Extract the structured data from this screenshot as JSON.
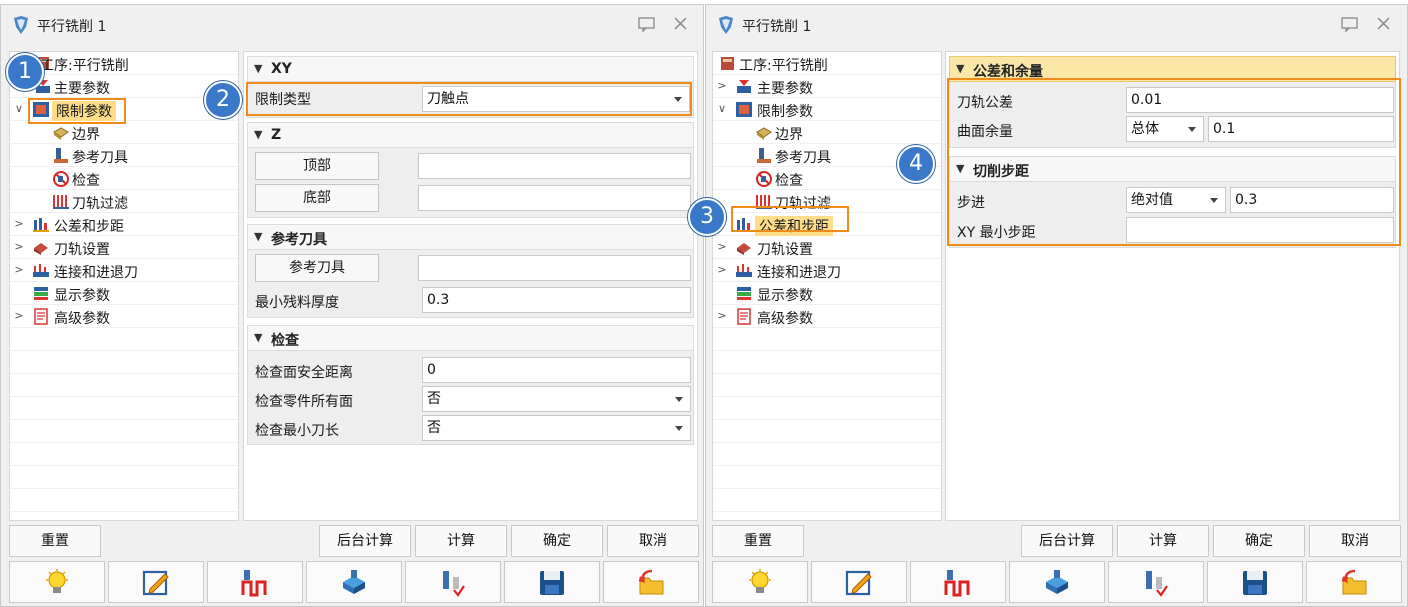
{
  "left_dialog": {
    "title": "平行铣削 1",
    "tree": {
      "items": [
        {
          "label": "工序:平行铣削"
        },
        {
          "label": "主要参数"
        },
        {
          "label": "限制参数"
        },
        {
          "label": "边界"
        },
        {
          "label": "参考刀具"
        },
        {
          "label": "检查"
        },
        {
          "label": "刀轨过滤"
        },
        {
          "label": "公差和步距"
        },
        {
          "label": "刀轨设置"
        },
        {
          "label": "连接和进退刀"
        },
        {
          "label": "显示参数"
        },
        {
          "label": "高级参数"
        }
      ],
      "selected": "限制参数"
    },
    "sections": {
      "xy": {
        "title": "XY",
        "limit_type_label": "限制类型",
        "limit_type_value": "刀触点"
      },
      "z": {
        "title": "Z",
        "top_button": "顶部",
        "bottom_button": "底部",
        "top_value": "",
        "bottom_value": ""
      },
      "ref_tool": {
        "title": "参考刀具",
        "ref_tool_button": "参考刀具",
        "ref_tool_value": "",
        "min_stock_label": "最小残料厚度",
        "min_stock_value": "0.3"
      },
      "check": {
        "title": "检查",
        "safe_dist_label": "检查面安全距离",
        "safe_dist_value": "0",
        "all_faces_label": "检查零件所有面",
        "all_faces_value": "否",
        "min_len_label": "检查最小刀长",
        "min_len_value": "否"
      }
    }
  },
  "right_dialog": {
    "title": "平行铣削 1",
    "tree": {
      "items": [
        {
          "label": "工序:平行铣削"
        },
        {
          "label": "主要参数"
        },
        {
          "label": "限制参数"
        },
        {
          "label": "边界"
        },
        {
          "label": "参考刀具"
        },
        {
          "label": "检查"
        },
        {
          "label": "刀轨过滤"
        },
        {
          "label": "公差和步距"
        },
        {
          "label": "刀轨设置"
        },
        {
          "label": "连接和进退刀"
        },
        {
          "label": "显示参数"
        },
        {
          "label": "高级参数"
        }
      ],
      "selected": "公差和步距"
    },
    "sections": {
      "tolerance": {
        "title": "公差和余量",
        "path_tol_label": "刀轨公差",
        "path_tol_value": "0.01",
        "surface_stock_label": "曲面余量",
        "surface_stock_mode": "总体",
        "surface_stock_value": "0.1"
      },
      "stepover": {
        "title": "切削步距",
        "step_label": "步进",
        "step_mode": "绝对值",
        "step_value": "0.3",
        "xy_min_step_label": "XY 最小步距",
        "xy_min_step_value": ""
      }
    }
  },
  "buttons": {
    "reset": "重置",
    "background_calc": "后台计算",
    "calc": "计算",
    "ok": "确定",
    "cancel": "取消"
  },
  "icon_buttons": [
    "lightbulb-icon",
    "edit-icon",
    "tool-path-icon",
    "tool-holder-icon",
    "tool-check-icon",
    "save-icon",
    "undo-folder-icon"
  ],
  "annotations": [
    "1",
    "2",
    "3",
    "4"
  ],
  "colors": {
    "highlight": "#f08a19",
    "badge": "#3a78c9",
    "selected_bg": "#fddc8a",
    "section_gold": "#fbe7a8"
  }
}
